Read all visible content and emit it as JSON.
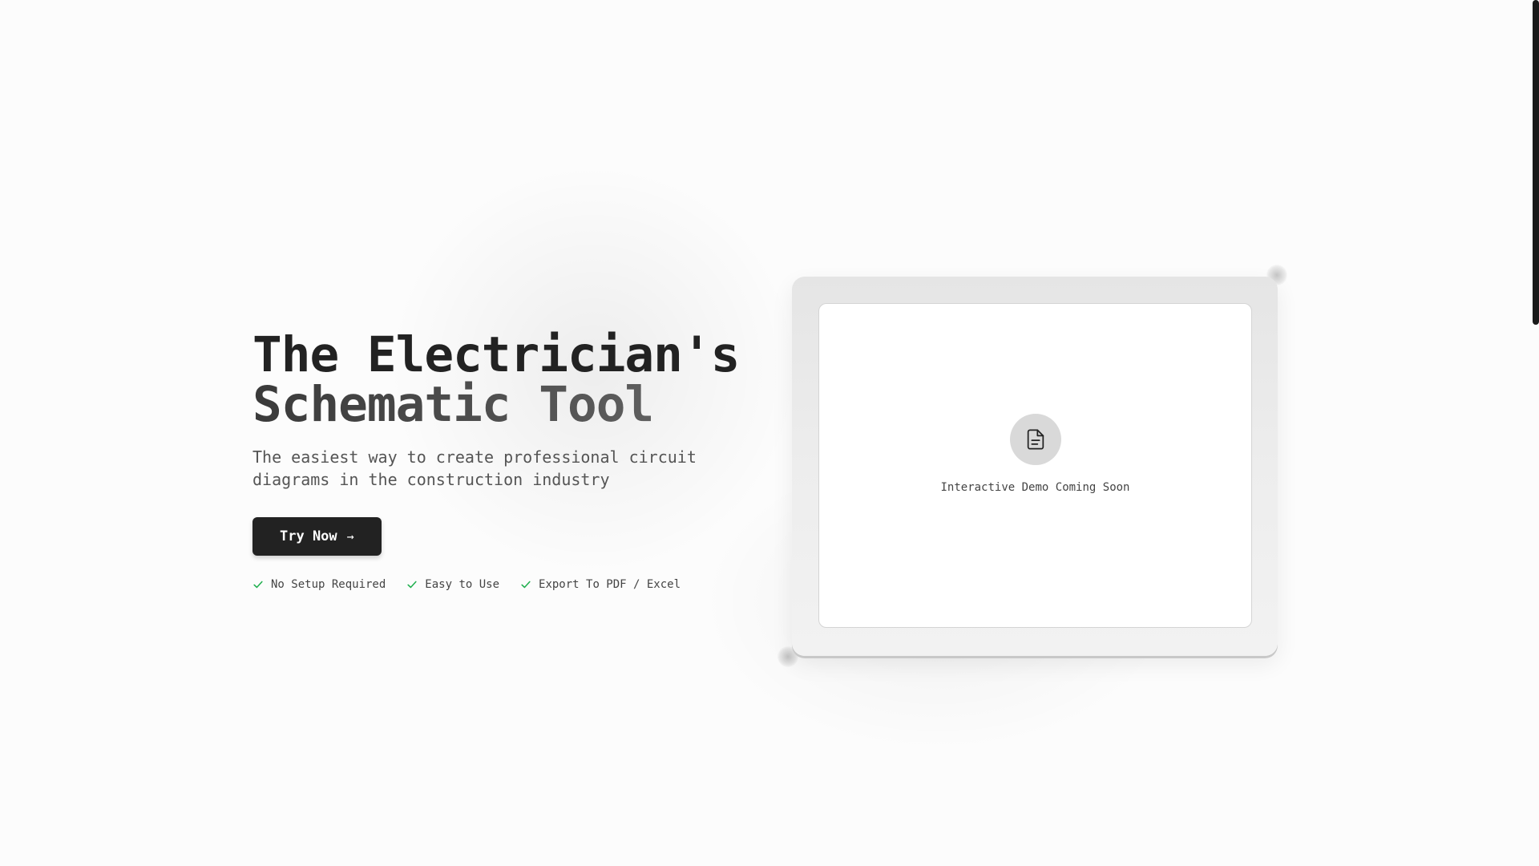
{
  "hero": {
    "title_line1": "The Electrician's",
    "title_line2": "Schematic Tool",
    "subtitle": "The easiest way to create professional circuit diagrams in the construction industry",
    "cta_label": "Try Now",
    "cta_icon": "arrow-right-icon",
    "features": [
      {
        "label": "No Setup Required",
        "icon": "check-icon"
      },
      {
        "label": "Easy to Use",
        "icon": "check-icon"
      },
      {
        "label": "Export To PDF / Excel",
        "icon": "check-icon"
      }
    ]
  },
  "demo": {
    "icon": "document-icon",
    "text": "Interactive Demo Coming Soon"
  },
  "colors": {
    "background": "#fcfcfc",
    "text_primary": "#222222",
    "button_bg": "#222222",
    "check_green": "#22b050",
    "frame_grey": "#e8e8e8"
  }
}
